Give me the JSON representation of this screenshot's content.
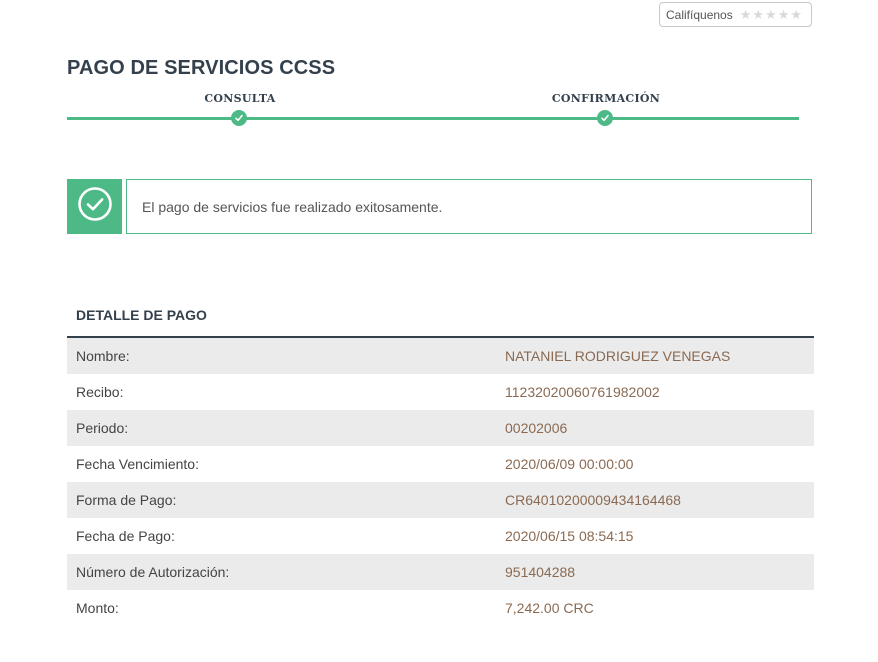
{
  "rating": {
    "label": "Califíquenos",
    "stars": 5,
    "selected": 0,
    "star_icon": "star-icon"
  },
  "page_title": "PAGO DE SERVICIOS CCSS",
  "steps": [
    {
      "label": "CONSULTA",
      "done": true
    },
    {
      "label": "CONFIRMACIÓN",
      "done": true
    }
  ],
  "alert": {
    "icon": "check-circle-icon",
    "message": "El pago de servicios fue realizado exitosamente."
  },
  "detail": {
    "title": "DETALLE DE PAGO",
    "rows": [
      {
        "label": "Nombre:",
        "value": "NATANIEL RODRIGUEZ VENEGAS"
      },
      {
        "label": "Recibo:",
        "value": "11232020060761982002"
      },
      {
        "label": "Periodo:",
        "value": "00202006"
      },
      {
        "label": "Fecha Vencimiento:",
        "value": "2020/06/09 00:00:00"
      },
      {
        "label": "Forma de Pago:",
        "value": "CR64010200009434164468"
      },
      {
        "label": "Fecha de Pago:",
        "value": "2020/06/15 08:54:15"
      },
      {
        "label": "Número de Autorización:",
        "value": "951404288"
      },
      {
        "label": "Monto:",
        "value": "7,242.00 CRC"
      }
    ]
  },
  "colors": {
    "accent": "#4cb987",
    "title": "#34404c",
    "value_text": "#8a6a52",
    "row_alt": "#ebebeb"
  }
}
